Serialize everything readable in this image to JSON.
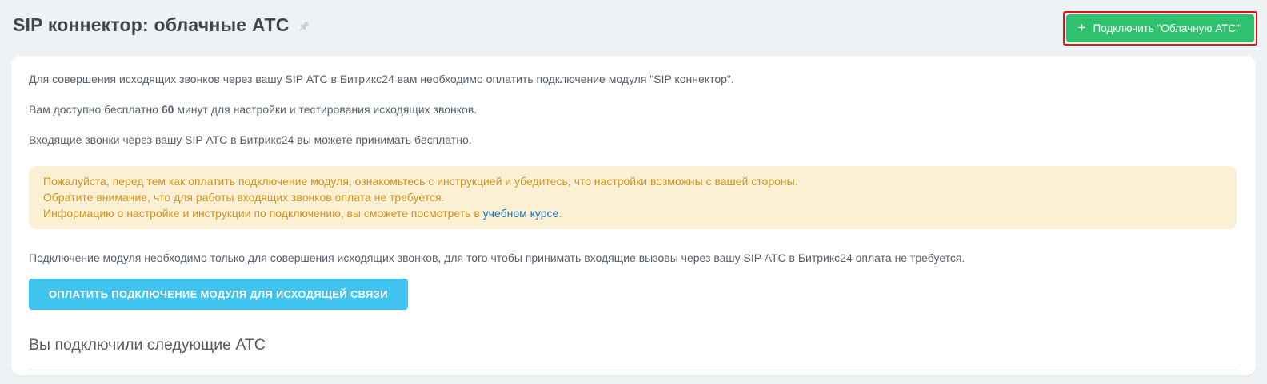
{
  "page": {
    "title": "SIP коннектор: облачные АТС"
  },
  "header": {
    "connect_button_label": "Подключить \"Облачную АТС\""
  },
  "icons": {
    "plus": "+",
    "pin": "pushpin"
  },
  "intro": {
    "p1": "Для совершения исходящих звонков через вашу SIP АТС в Битрикс24 вам необходимо оплатить подключение модуля \"SIP коннектор\".",
    "p2_prefix": "Вам доступно бесплатно ",
    "p2_minutes": "60",
    "p2_suffix": " минут для настройки и тестирования исходящих звонков.",
    "p3": "Входящие звонки через вашу SIP АТС в Битрикс24 вы можете принимать бесплатно."
  },
  "notice": {
    "line1": "Пожалуйста, перед тем как оплатить подключение модуля, ознакомьтесь с инструкцией и убедитесь, что настройки возможны с вашей стороны.",
    "line2": "Обратите внимание, что для работы входящих звонков оплата не требуется.",
    "line3_prefix": "Информацию о настройке и инструкции по подключению, вы сможете посмотреть в ",
    "line3_link": "учебном курсе",
    "line3_suffix": "."
  },
  "main": {
    "p4": "Подключение модуля необходимо только для совершения исходящих звонков, для того чтобы принимать входящие вызовы через вашу SIP АТС в Битрикс24 оплата не требуется.",
    "pay_button_label": "ОПЛАТИТЬ ПОДКЛЮЧЕНИЕ МОДУЛЯ ДЛЯ ИСХОДЯЩЕЙ СВЯЗИ",
    "connected_heading": "Вы подключили следующие АТС"
  },
  "colors": {
    "page_background": "#eef2f5",
    "card_background": "#ffffff",
    "connect_button_green": "#2fc26e",
    "highlight_outline_red": "#e01414",
    "pay_button_blue": "#3fc3ef",
    "notice_background": "#fbf0d3",
    "notice_text": "#d09421",
    "link_blue": "#1e73be",
    "body_text": "#545f6b"
  }
}
